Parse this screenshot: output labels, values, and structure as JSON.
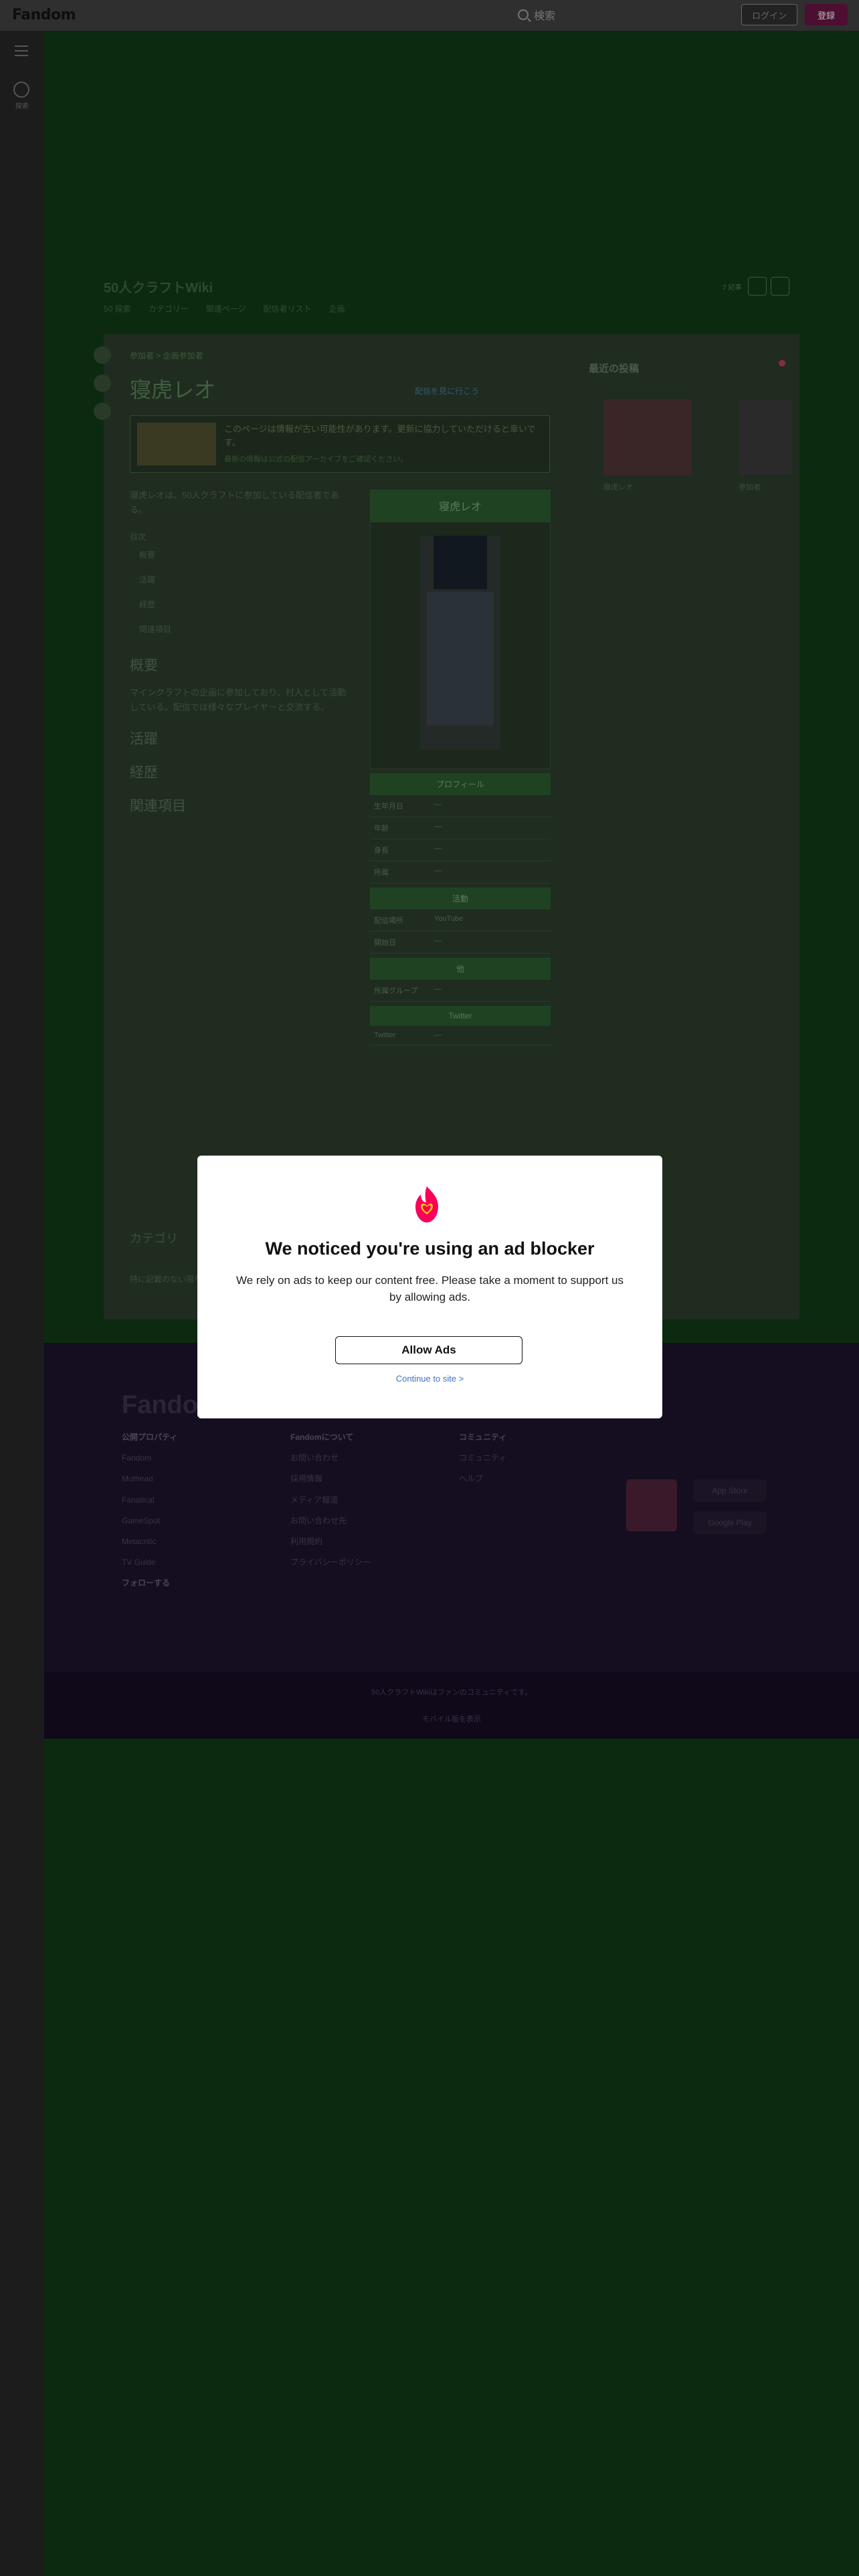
{
  "topbar": {
    "logo": "Fandom",
    "search_placeholder": "検索",
    "login_label": "ログイン",
    "register_label": "登録"
  },
  "rail": {
    "explore_label": "探索"
  },
  "wiki": {
    "title": "50人クラフトWiki",
    "nav": [
      "50 探索",
      "カテゴリー",
      "関連ページ",
      "配信者リスト",
      "企画"
    ],
    "tools_label": "7 記事"
  },
  "page": {
    "breadcrumb": "参加者 > 企画参加者",
    "title": "寝虎レオ",
    "edit_link": "配信を見に行こう",
    "notice_text": "このページは情報が古い可能性があります。更新に協力していただけると幸いです。",
    "notice_sub": "最新の情報は公式の配信アーカイブをご確認ください。",
    "intro": "寝虎レオは、50人クラフトに参加している配信者である。",
    "toc_title": "目次",
    "toc": [
      "概要",
      "活躍",
      "経歴",
      "関連項目"
    ],
    "sections": [
      {
        "heading": "概要",
        "text": "マインクラフトの企画に参加しており、村人として活動している。配信では様々なプレイヤーと交流する。"
      },
      {
        "heading": "活躍",
        "text": ""
      },
      {
        "heading": "経歴",
        "text": ""
      },
      {
        "heading": "関連項目",
        "text": ""
      }
    ],
    "categories_label": "カテゴリ",
    "cat_footer": "特に記載のない限り、コミュニティのコンテンツはCC BY-SAライセンスの下で利用可能です。"
  },
  "infobox": {
    "title": "寝虎レオ",
    "sections": [
      {
        "name": "プロフィール",
        "rows": [
          [
            "生年月日",
            "—"
          ],
          [
            "年齢",
            "—"
          ],
          [
            "身長",
            "—"
          ],
          [
            "所属",
            "—"
          ]
        ]
      },
      {
        "name": "活動",
        "rows": [
          [
            "配信場所",
            "YouTube"
          ],
          [
            "開始日",
            "—"
          ]
        ]
      },
      {
        "name": "他",
        "rows": [
          [
            "所属グループ",
            "—"
          ]
        ]
      },
      {
        "name": "Twitter",
        "rows": [
          [
            "Twitter",
            "—"
          ]
        ]
      }
    ]
  },
  "popular": {
    "title": "最近の投稿",
    "items": [
      "寝虎レオ",
      "参加者"
    ]
  },
  "footer": {
    "logo": "Fandom",
    "col1_head": "公開プロパティ",
    "col1": [
      "Fandom",
      "Muthead",
      "Fanatical",
      "GameSpot",
      "Metacritic",
      "TV Guide"
    ],
    "col2_head": "Fandomについて",
    "col2": [
      "お問い合わせ",
      "採用情報",
      "メディア報道",
      "お問い合わせ先",
      "利用規約",
      "プライバシーポリシー"
    ],
    "col3_head": "コミュニティ",
    "col3": [
      "コミュニティ",
      "ヘルプ"
    ],
    "follow_label": "フォローする",
    "app_store": "App Store",
    "google_play": "Google Play",
    "bottom_text": "50人クラフトWikiはファンのコミュニティです。",
    "bottom_link": "モバイル版を表示"
  },
  "modal": {
    "title": "We noticed you're using an ad blocker",
    "body": "We rely on ads to keep our content free. Please take a moment to support us by allowing ads.",
    "allow_label": "Allow Ads",
    "continue_label": "Continue to site >",
    "icon": "fandom-flame-heart-icon",
    "accent": "#fa005a"
  }
}
